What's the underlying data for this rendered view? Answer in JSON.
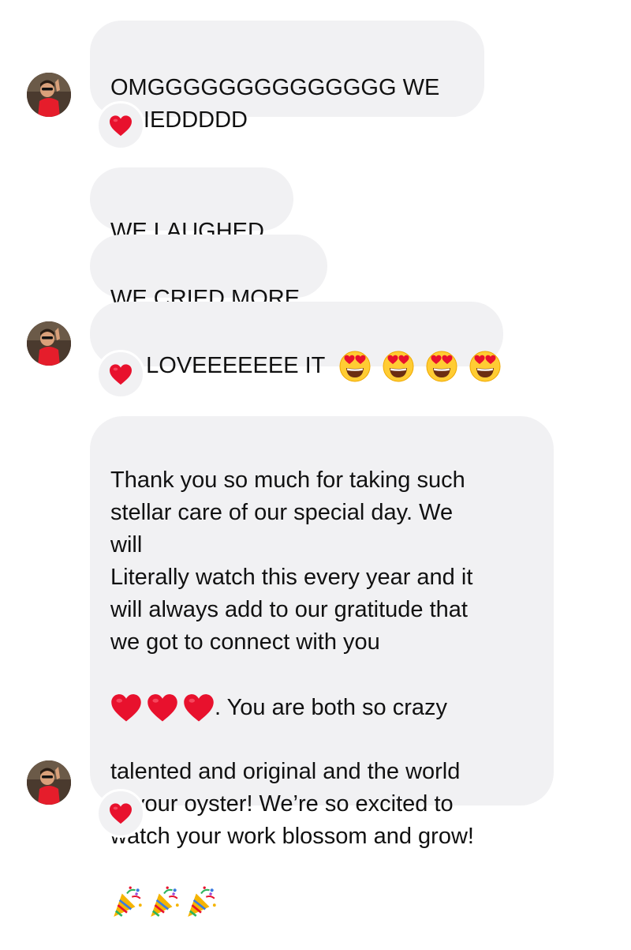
{
  "conversation": {
    "messages": [
      {
        "text": "OMGGGGGGGGGGGGGG WE\nCRIEDDDDD",
        "reaction": "red-heart"
      },
      {
        "text": "WE LAUGHED"
      },
      {
        "text": "WE CRIED MORE"
      },
      {
        "text": "we LOVEEEEEEE IT",
        "emojis": [
          "heart-eyes",
          "heart-eyes",
          "heart-eyes",
          "heart-eyes"
        ],
        "reaction": "red-heart"
      },
      {
        "text_part1": "Thank you so much for taking such\nstellar care of our special day. We\nwill\nLiterally watch this every year and it\nwill always add to our gratitude that\nwe got to connect with you",
        "text_part2": ". You are both so crazy",
        "text_part3": "talented and original and the world\nis your oyster! We’re so excited to\nwatch your work blossom and grow!",
        "inline_emojis": [
          "red-heart",
          "red-heart",
          "red-heart"
        ],
        "trailing_emojis": [
          "party-popper",
          "party-popper",
          "party-popper"
        ],
        "reaction": "red-heart"
      }
    ]
  },
  "colors": {
    "bubble": "#f1f1f3",
    "heart": "#e8112d",
    "text": "#111111"
  }
}
